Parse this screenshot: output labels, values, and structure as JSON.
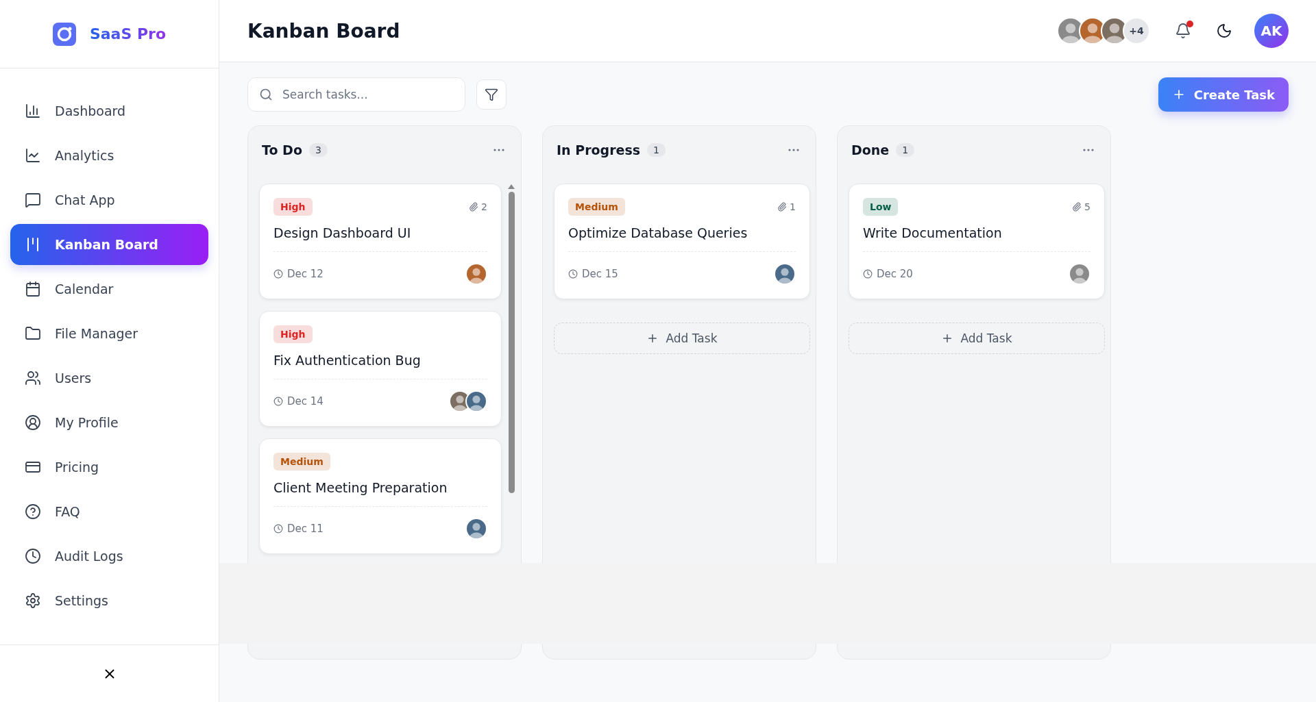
{
  "brand": {
    "name": "SaaS Pro"
  },
  "sidebar": {
    "items": [
      {
        "label": "Dashboard",
        "selected": false
      },
      {
        "label": "Analytics",
        "selected": false
      },
      {
        "label": "Chat App",
        "selected": false
      },
      {
        "label": "Kanban Board",
        "selected": true
      },
      {
        "label": "Calendar",
        "selected": false
      },
      {
        "label": "File Manager",
        "selected": false
      },
      {
        "label": "Users",
        "selected": false
      },
      {
        "label": "My Profile",
        "selected": false
      },
      {
        "label": "Pricing",
        "selected": false
      },
      {
        "label": "FAQ",
        "selected": false
      },
      {
        "label": "Audit Logs",
        "selected": false
      },
      {
        "label": "Settings",
        "selected": false
      }
    ]
  },
  "header": {
    "title": "Kanban Board",
    "team_more": "+4",
    "notifications": {
      "unread": true
    },
    "user_initials": "AK"
  },
  "toolbar": {
    "search": {
      "placeholder": "Search tasks..."
    },
    "create_button": "Create Task"
  },
  "columns": [
    {
      "title": "To Do",
      "count": "3",
      "scrollable": true,
      "cards": [
        {
          "priority": "High",
          "color": "#dc2626",
          "title": "Design Dashboard UI",
          "attachments": "2",
          "due": "Dec 12"
        },
        {
          "priority": "High",
          "color": "#dc2626",
          "title": "Fix Authentication Bug",
          "due": "Dec 14"
        },
        {
          "priority": "Medium",
          "color": "#b45309",
          "title": "Client Meeting Preparation",
          "due": "Dec 11"
        }
      ]
    },
    {
      "title": "In Progress",
      "count": "1",
      "scrollable": false,
      "add_button": "Add Task",
      "cards": [
        {
          "priority": "Medium",
          "color": "#b45309",
          "title": "Optimize Database Queries",
          "attachments": "1",
          "due": "Dec 15"
        }
      ]
    },
    {
      "title": "Done",
      "count": "1",
      "scrollable": false,
      "add_button": "Add Task",
      "cards": [
        {
          "priority": "Low",
          "color": "#065f46",
          "title": "Write Documentation",
          "attachments": "5",
          "due": "Dec 20"
        }
      ]
    }
  ]
}
